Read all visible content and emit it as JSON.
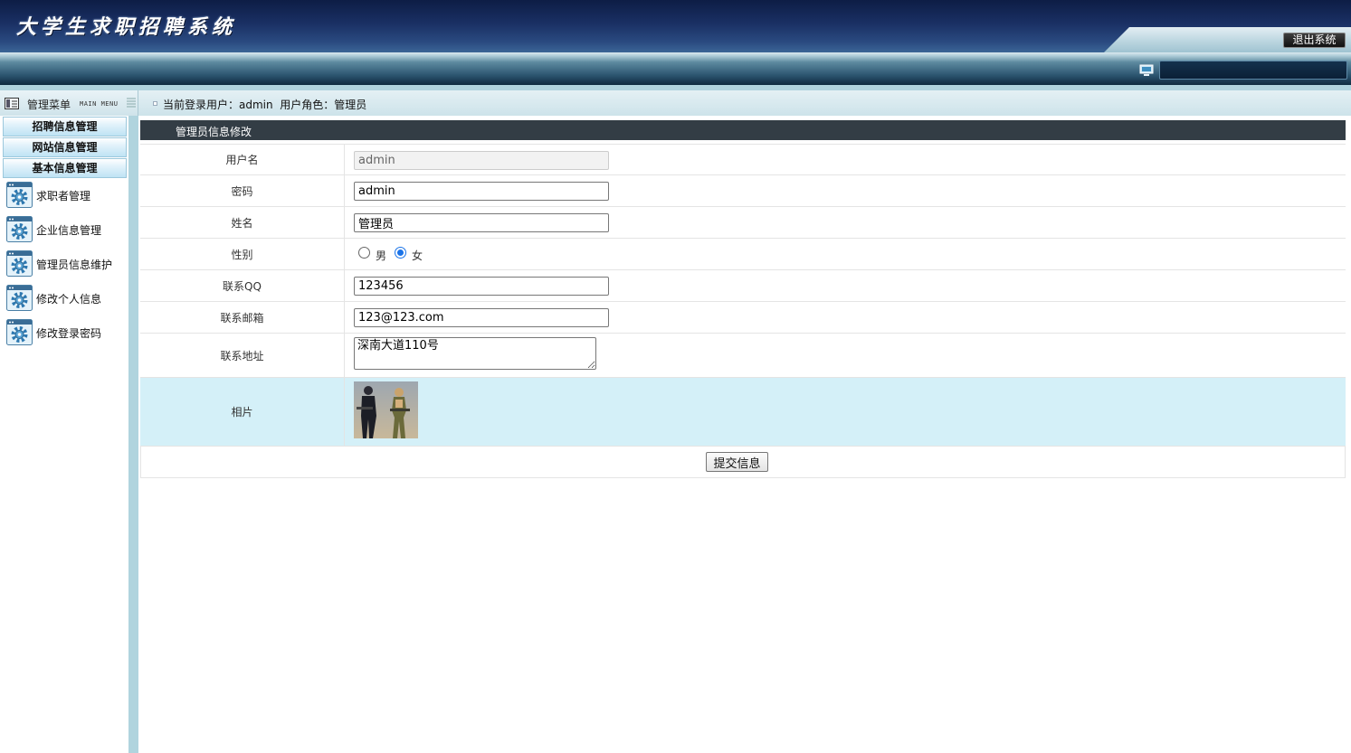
{
  "app": {
    "title": "大学生求职招聘系统",
    "logout_label": "退出系统"
  },
  "sidebar": {
    "title": "管理菜单",
    "subtitle": "MAIN MENU",
    "categories": [
      {
        "label": "招聘信息管理"
      },
      {
        "label": "网站信息管理"
      },
      {
        "label": "基本信息管理"
      }
    ],
    "items": [
      {
        "label": "求职者管理",
        "icon": "gear-window-icon"
      },
      {
        "label": "企业信息管理",
        "icon": "gear-window-icon"
      },
      {
        "label": "管理员信息维护",
        "icon": "gear-window-icon"
      },
      {
        "label": "修改个人信息",
        "icon": "gear-window-icon"
      },
      {
        "label": "修改登录密码",
        "icon": "gear-window-icon"
      }
    ]
  },
  "status": {
    "login_text": "当前登录用户：admin  用户角色：管理员"
  },
  "form": {
    "title": "管理员信息修改",
    "fields": {
      "username": {
        "label": "用户名",
        "value": "admin"
      },
      "password": {
        "label": "密码",
        "value": "admin"
      },
      "name": {
        "label": "姓名",
        "value": "管理员"
      },
      "gender": {
        "label": "性别",
        "options": [
          "男",
          "女"
        ],
        "selected": "女"
      },
      "qq": {
        "label": "联系QQ",
        "value": "123456"
      },
      "email": {
        "label": "联系邮箱",
        "value": "123@123.com"
      },
      "address": {
        "label": "联系地址",
        "value": "深南大道110号"
      },
      "photo": {
        "label": "相片"
      }
    },
    "submit_label": "提交信息"
  },
  "colors": {
    "accent": "#1a73e8",
    "title_bar": "#333d45",
    "highlight_row": "#d4f0f8",
    "frame": "#b0d4de"
  }
}
